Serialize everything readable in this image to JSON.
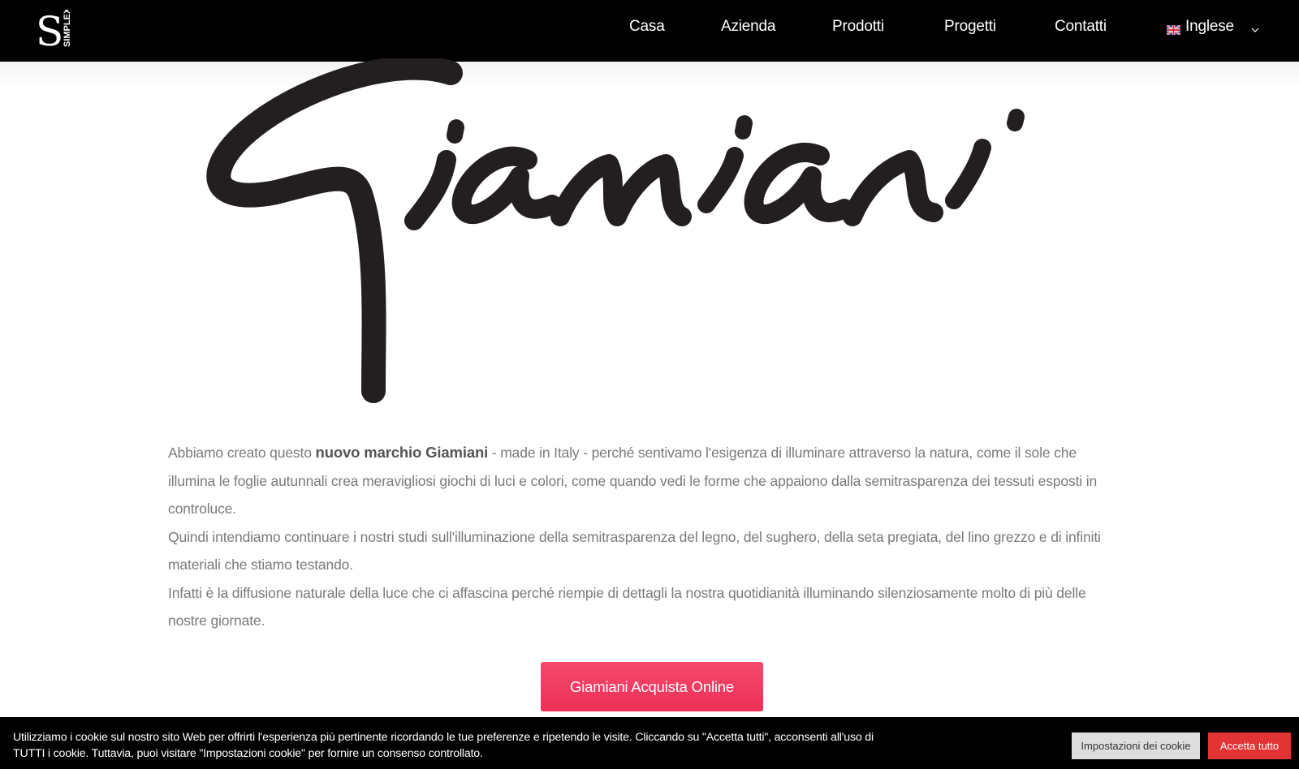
{
  "header": {
    "logo": {
      "letter": "S",
      "word": "SIMPLEX",
      "icon": "simplex-logo"
    },
    "nav": [
      {
        "label": "Casa"
      },
      {
        "label": "Azienda"
      },
      {
        "label": "Prodotti"
      },
      {
        "label": "Progetti"
      },
      {
        "label": "Contatti"
      }
    ],
    "language": {
      "label": "Inglese",
      "flag_icon": "uk-flag-icon",
      "chevron_icon": "chevron-down-icon"
    }
  },
  "brand": {
    "signature_text": "Giamiani"
  },
  "content": {
    "p1": {
      "before": "Abbiamo creato questo ",
      "bold": "nuovo marchio Giamiani",
      "after": " - made in Italy - perché sentivamo l'esigenza di illuminare attraverso la natura, come il sole che illumina le foglie autunnali crea meravigliosi giochi di luci e colori, come quando vedi le forme che appaiono dalla semitrasparenza dei tessuti esposti in controluce."
    },
    "p2": "Quindi intendiamo continuare i nostri studi sull'illuminazione della semitrasparenza del legno, del sughero, della seta pregiata, del lino grezzo e di infiniti materiali che stiamo testando.",
    "p3": "Infatti è la diffusione naturale della luce che ci affascina perché riempie di dettagli la nostra quotidianità illuminando silenziosamente molto di più delle nostre giornate."
  },
  "cta": {
    "label": "Giamiani Acquista Online",
    "color": "#f0385e"
  },
  "cookie": {
    "text": "Utilizziamo i cookie sul nostro sito Web per offrirti l'esperienza più pertinente ricordando le tue preferenze e ripetendo le visite. Cliccando su \"Accetta tutti\", acconsenti all'uso di TUTTI i cookie. Tuttavia, puoi visitare \"Impostazioni cookie\" per fornire un consenso controllato.",
    "settings_label": "Impostazioni dei cookie",
    "accept_label": "Accetta tutto",
    "accept_color": "#e23434"
  }
}
